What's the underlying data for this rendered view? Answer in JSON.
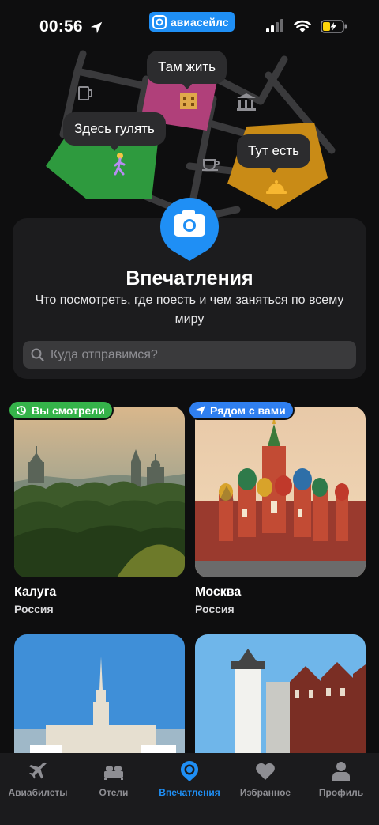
{
  "status_bar": {
    "time": "00:56",
    "app_badge": "авиасейлс"
  },
  "map": {
    "bubbles": {
      "live": "Там жить",
      "walk": "Здесь гулять",
      "eat": "Тут есть"
    },
    "colors": {
      "pink": "#b0407a",
      "green": "#2e9a3e",
      "orange": "#c98b16"
    }
  },
  "hero": {
    "title": "Впечатления",
    "subtitle": "Что посмотреть, где поесть и чем заняться по всему миру",
    "search_placeholder": "Куда отправимся?"
  },
  "destinations": [
    {
      "tag": "Вы смотрели",
      "name": "Калуга",
      "country": "Россия"
    },
    {
      "tag": "Рядом с вами",
      "name": "Москва",
      "country": "Россия"
    },
    {
      "name": "",
      "country": ""
    },
    {
      "name": "",
      "country": ""
    }
  ],
  "tabs": [
    {
      "label": "Авиабилеты",
      "icon": "plane-icon"
    },
    {
      "label": "Отели",
      "icon": "bed-icon"
    },
    {
      "label": "Впечатления",
      "icon": "pin-icon",
      "active": true
    },
    {
      "label": "Избранное",
      "icon": "heart-icon"
    },
    {
      "label": "Профиль",
      "icon": "person-icon"
    }
  ],
  "accent_color": "#1f8ff5"
}
